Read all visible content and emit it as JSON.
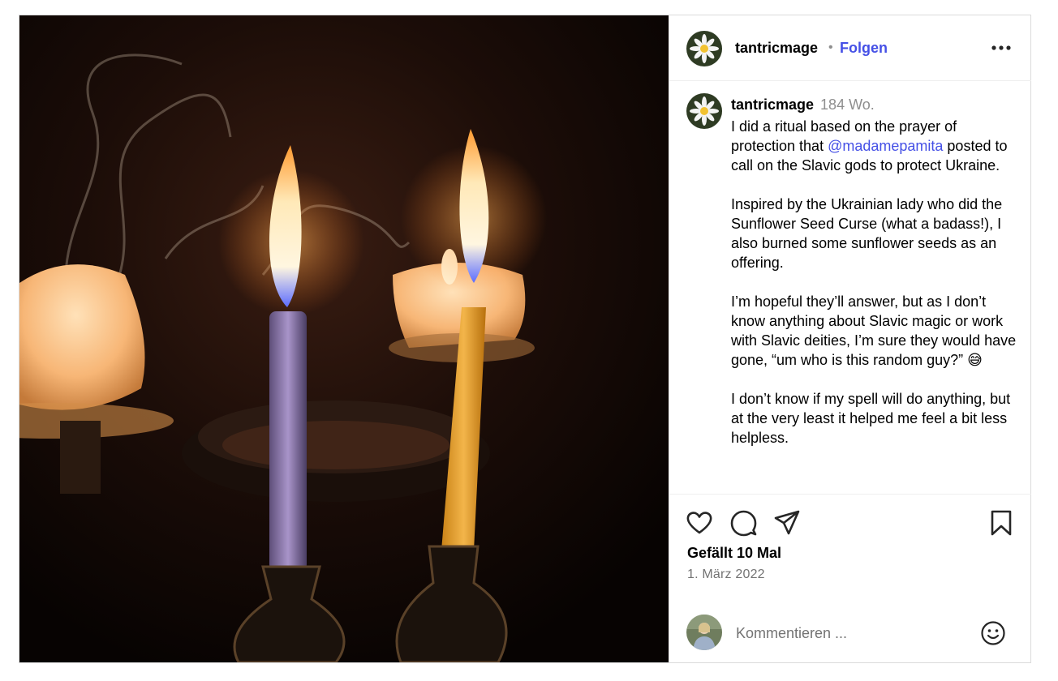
{
  "header": {
    "username": "tantricmage",
    "separator": "•",
    "follow_label": "Folgen",
    "more_icon": "more-horizontal-icon"
  },
  "caption": {
    "username": "tantricmage",
    "time": "184 Wo.",
    "p1_before": "I did a ritual based on the prayer of protection that ",
    "mention": "@madamepamita",
    "p1_after": " posted to call on the Slavic gods to protect Ukraine.",
    "p2": "Inspired by the Ukrainian lady who did the Sunflower Seed Curse (what a badass!), I also burned some sunflower seeds as an offering.",
    "p3": "I’m hopeful they’ll answer, but as I don’t know anything about Slavic magic or work with Slavic deities, I’m sure they would have gone, “um who is this random guy?” 😅",
    "p4": "I don’t know if my spell will do anything, but at the very least it helped me feel a bit less helpless."
  },
  "actions": {
    "icons": [
      "heart-icon",
      "comment-icon",
      "share-icon",
      "bookmark-icon"
    ],
    "likes": "Gefällt 10 Mal",
    "date": "1. März 2022"
  },
  "comment": {
    "placeholder": "Kommentieren ...",
    "emoji_icon": "smiley-icon"
  },
  "colors": {
    "link": "#4550e6",
    "muted": "#8e8e8e",
    "border": "#dbdbdb"
  }
}
